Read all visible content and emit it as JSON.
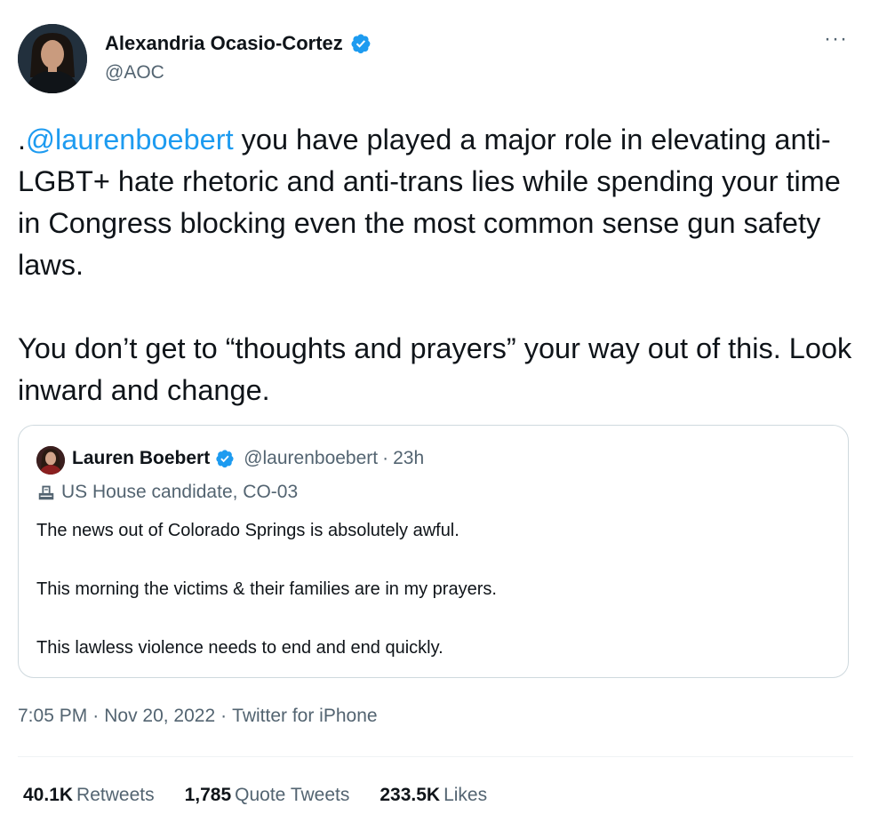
{
  "author": {
    "display_name": "Alexandria Ocasio-Cortez",
    "handle": "@AOC",
    "verified_icon": "verified-badge",
    "more_label": "···"
  },
  "tweet": {
    "mention": "@laurenboebert",
    "prefix": ".",
    "text_1_rest": " you have played a major role in elevating anti-LGBT+ hate rhetoric and anti-trans lies while spending your time in Congress blocking even the most common sense gun safety laws.",
    "text_2": "You don’t get to “thoughts and prayers” your way out of this. Look inward and change."
  },
  "quoted_tweet": {
    "display_name": "Lauren Boebert",
    "handle": "@laurenboebert",
    "separator": "·",
    "time": "23h",
    "label_icon": "ballot-box-icon",
    "label": "US House candidate, CO-03",
    "paragraphs": [
      "The news out of Colorado Springs is absolutely awful.",
      "This morning the victims & their families are in my prayers.",
      "This lawless violence needs to end and end quickly."
    ]
  },
  "meta": {
    "time": "7:05 PM",
    "date": "Nov 20, 2022",
    "source": "Twitter for iPhone",
    "separator": "·"
  },
  "stats": {
    "retweets_count": "40.1K",
    "retweets_label": "Retweets",
    "quotes_count": "1,785",
    "quotes_label": "Quote Tweets",
    "likes_count": "233.5K",
    "likes_label": "Likes"
  },
  "colors": {
    "link": "#1d9bf0",
    "text": "#0f1419",
    "secondary": "#536471",
    "border": "#cfd9de"
  }
}
